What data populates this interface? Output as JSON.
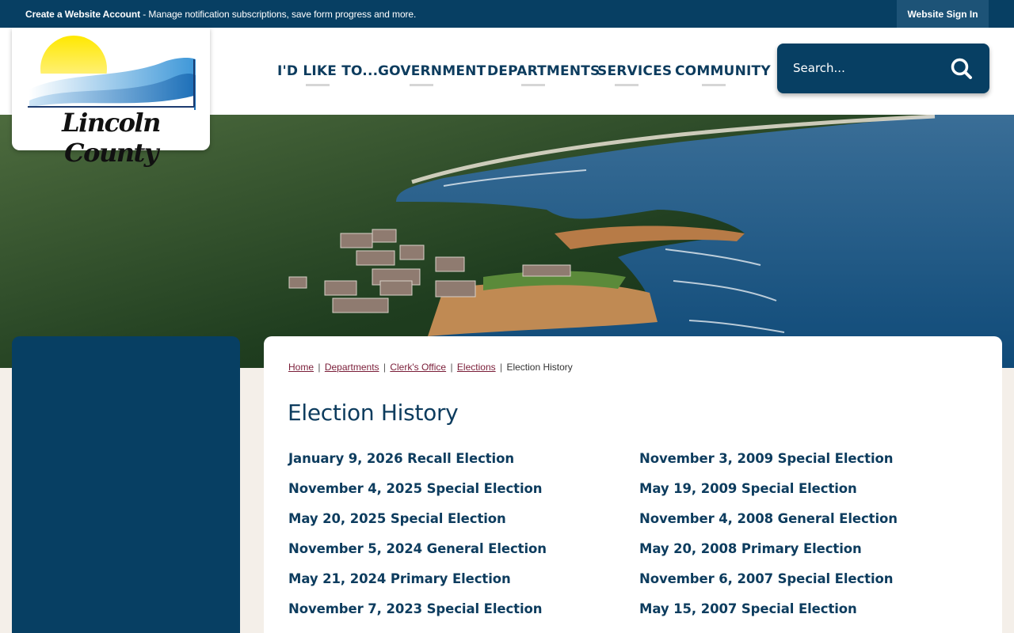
{
  "topbar": {
    "account_label": "Create a Website Account",
    "account_desc": " - Manage notification subscriptions, save form progress and more.",
    "signin_label": "Website Sign In"
  },
  "logo": {
    "text": "Lincoln County"
  },
  "nav": {
    "items": [
      {
        "label": "I'D LIKE TO..."
      },
      {
        "label": "GOVERNMENT"
      },
      {
        "label": "DEPARTMENTS"
      },
      {
        "label": "SERVICES"
      },
      {
        "label": "COMMUNITY"
      }
    ]
  },
  "search": {
    "placeholder": "Search..."
  },
  "breadcrumb": {
    "home": "Home",
    "departments": "Departments",
    "clerk": "Clerk's Office",
    "elections": "Elections",
    "current": "Election History",
    "separator": "|"
  },
  "page": {
    "title": "Election History"
  },
  "elections": {
    "left": [
      "January 9, 2026 Recall Election",
      "November 4, 2025 Special Election",
      "May 20, 2025 Special Election",
      "November 5, 2024 General Election",
      "May 21, 2024 Primary Election",
      "November 7, 2023 Special Election"
    ],
    "right": [
      "November 3, 2009 Special Election",
      "May 19, 2009 Special Election",
      "November 4, 2008 General Election",
      "May 20, 2008 Primary Election",
      "November 6, 2007 Special Election",
      "May 15, 2007 Special Election"
    ]
  },
  "colors": {
    "primary": "#073f63",
    "link": "#0d3c5e",
    "breadcrumb_link": "#7a1d38",
    "page_bg": "#f4efe9"
  }
}
